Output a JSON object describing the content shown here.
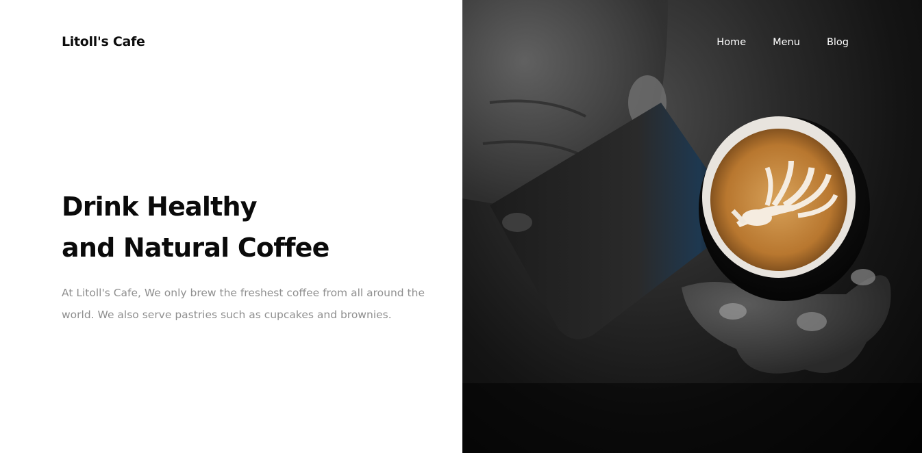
{
  "brand": {
    "name": "Litoll's Cafe"
  },
  "nav": {
    "items": [
      {
        "label": "Home"
      },
      {
        "label": "Menu"
      },
      {
        "label": "Blog"
      }
    ]
  },
  "hero": {
    "headline_line1": "Drink Healthy",
    "headline_line2": "and Natural Coffee",
    "description": "At Litoll's Cafe, We only brew the freshest coffee from all around the world. We also serve pastries such as cupcakes and brownies."
  },
  "image": {
    "subject": "latte-art-pour-photo"
  },
  "colors": {
    "background_left": "#ffffff",
    "text_dark": "#0a0a0a",
    "text_muted": "#8f8f8f",
    "nav_text": "#ffffff",
    "coffee": "#c98a3e"
  }
}
